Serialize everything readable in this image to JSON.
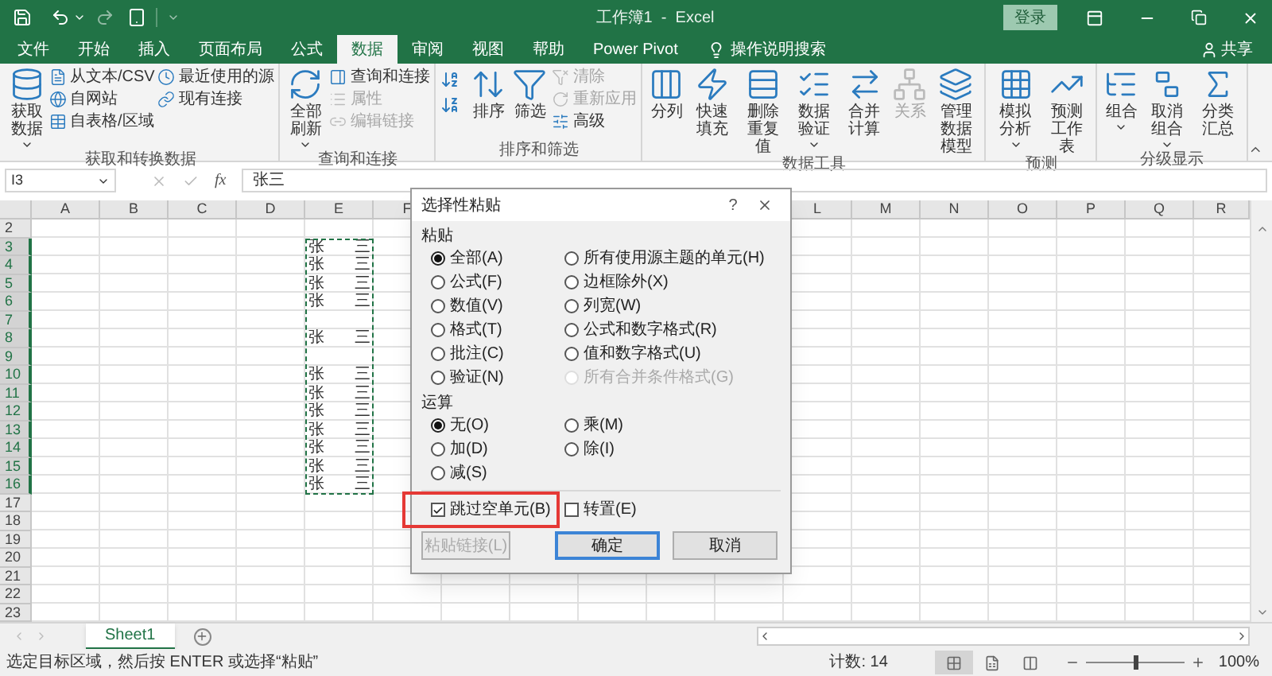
{
  "title_bar": {
    "title": "工作簿1  -  Excel",
    "login_button": "登录"
  },
  "ribbon_tabs": [
    {
      "label": "文件",
      "selected": false
    },
    {
      "label": "开始",
      "selected": false
    },
    {
      "label": "插入",
      "selected": false
    },
    {
      "label": "页面布局",
      "selected": false
    },
    {
      "label": "公式",
      "selected": false
    },
    {
      "label": "数据",
      "selected": true
    },
    {
      "label": "审阅",
      "selected": false
    },
    {
      "label": "视图",
      "selected": false
    },
    {
      "label": "帮助",
      "selected": false
    },
    {
      "label": "Power Pivot",
      "selected": false
    }
  ],
  "tell_me": "操作说明搜索",
  "share": "共享",
  "ribbon_groups": [
    {
      "label": "获取和转换数据",
      "items": [
        {
          "kind": "large",
          "label": "获取数据",
          "dropdown": true,
          "disabled": false
        },
        {
          "kind": "stack",
          "items": [
            {
              "label": "从文本/CSV",
              "disabled": false
            },
            {
              "label": "自网站",
              "disabled": false
            },
            {
              "label": "自表格/区域",
              "disabled": false
            }
          ]
        },
        {
          "kind": "stack",
          "items": [
            {
              "label": "最近使用的源",
              "disabled": false
            },
            {
              "label": "现有连接",
              "disabled": false
            }
          ]
        }
      ]
    },
    {
      "label": "查询和连接",
      "items": [
        {
          "kind": "large",
          "label": "全部刷新",
          "dropdown": true,
          "disabled": false
        },
        {
          "kind": "stack",
          "items": [
            {
              "label": "查询和连接",
              "disabled": false
            },
            {
              "label": "属性",
              "disabled": true
            },
            {
              "label": "编辑链接",
              "disabled": true
            }
          ]
        }
      ]
    },
    {
      "label": "排序和筛选",
      "items": [
        {
          "kind": "sort_icons"
        },
        {
          "kind": "large",
          "label": "排序",
          "dropdown": false,
          "disabled": false
        },
        {
          "kind": "large",
          "label": "筛选",
          "dropdown": false,
          "disabled": false
        },
        {
          "kind": "stack",
          "items": [
            {
              "label": "清除",
              "disabled": true
            },
            {
              "label": "重新应用",
              "disabled": true
            },
            {
              "label": "高级",
              "disabled": false
            }
          ]
        }
      ]
    },
    {
      "label": "数据工具",
      "items": [
        {
          "kind": "large",
          "label": "分列",
          "dropdown": false,
          "disabled": false
        },
        {
          "kind": "large",
          "label": "快速填充",
          "dropdown": false,
          "disabled": false
        },
        {
          "kind": "large",
          "label": "删除重复值",
          "dropdown": false,
          "disabled": false
        },
        {
          "kind": "large",
          "label": "数据验证",
          "dropdown": true,
          "disabled": false
        },
        {
          "kind": "large",
          "label": "合并计算",
          "dropdown": false,
          "disabled": false
        },
        {
          "kind": "large",
          "label": "关系",
          "dropdown": false,
          "disabled": true
        },
        {
          "kind": "large",
          "label": "管理数据模型",
          "dropdown": false,
          "disabled": false
        }
      ]
    },
    {
      "label": "预测",
      "items": [
        {
          "kind": "large",
          "label": "模拟分析",
          "dropdown": true,
          "disabled": false
        },
        {
          "kind": "large",
          "label": "预测工作表",
          "dropdown": false,
          "disabled": false
        }
      ]
    },
    {
      "label": "分级显示",
      "items": [
        {
          "kind": "large",
          "label": "组合",
          "dropdown": true,
          "disabled": false
        },
        {
          "kind": "large",
          "label": "取消组合",
          "dropdown": true,
          "disabled": false
        },
        {
          "kind": "large",
          "label": "分类汇总",
          "dropdown": false,
          "disabled": false
        }
      ]
    }
  ],
  "formula_bar": {
    "name_box": "I3",
    "function_label": "fx",
    "value": "张三"
  },
  "grid": {
    "columns": [
      "A",
      "B",
      "C",
      "D",
      "E",
      "F",
      null,
      null,
      null,
      null,
      null,
      "L",
      "M",
      "N",
      "O",
      "P",
      "Q",
      "R"
    ],
    "rows": [
      {
        "label": "2",
        "selected": false,
        "cells": []
      },
      {
        "label": "3",
        "selected": true,
        "cells": [
          null,
          null,
          null,
          null,
          "张三"
        ]
      },
      {
        "label": "4",
        "selected": true,
        "cells": [
          null,
          null,
          null,
          null,
          "张三"
        ]
      },
      {
        "label": "5",
        "selected": true,
        "cells": [
          null,
          null,
          null,
          null,
          "张三"
        ]
      },
      {
        "label": "6",
        "selected": true,
        "cells": [
          null,
          null,
          null,
          null,
          "张三"
        ]
      },
      {
        "label": "7",
        "selected": true,
        "cells": []
      },
      {
        "label": "8",
        "selected": true,
        "cells": [
          null,
          null,
          null,
          null,
          "张三"
        ]
      },
      {
        "label": "9",
        "selected": true,
        "cells": []
      },
      {
        "label": "10",
        "selected": true,
        "cells": [
          null,
          null,
          null,
          null,
          "张三"
        ]
      },
      {
        "label": "11",
        "selected": true,
        "cells": [
          null,
          null,
          null,
          null,
          "张三"
        ]
      },
      {
        "label": "12",
        "selected": true,
        "cells": [
          null,
          null,
          null,
          null,
          "张三"
        ]
      },
      {
        "label": "13",
        "selected": true,
        "cells": [
          null,
          null,
          null,
          null,
          "张三"
        ]
      },
      {
        "label": "14",
        "selected": true,
        "cells": [
          null,
          null,
          null,
          null,
          "张三"
        ]
      },
      {
        "label": "15",
        "selected": true,
        "cells": [
          null,
          null,
          null,
          null,
          "张三"
        ]
      },
      {
        "label": "16",
        "selected": true,
        "cells": [
          null,
          null,
          null,
          null,
          "张三"
        ]
      },
      {
        "label": "17",
        "selected": false,
        "cells": []
      },
      {
        "label": "18",
        "selected": false,
        "cells": []
      },
      {
        "label": "19",
        "selected": false,
        "cells": []
      },
      {
        "label": "20",
        "selected": false,
        "cells": []
      },
      {
        "label": "21",
        "selected": false,
        "cells": []
      },
      {
        "label": "22",
        "selected": false,
        "cells": []
      },
      {
        "label": "23",
        "selected": false,
        "cells": []
      }
    ]
  },
  "dialog": {
    "title": "选择性粘贴",
    "help": "?",
    "paste_label": "粘贴",
    "paste_options": [
      {
        "label": "全部(A)",
        "selected": true,
        "disabled": false
      },
      {
        "label": "所有使用源主题的单元(H)",
        "selected": false,
        "disabled": false
      },
      {
        "label": "公式(F)",
        "selected": false,
        "disabled": false
      },
      {
        "label": "边框除外(X)",
        "selected": false,
        "disabled": false
      },
      {
        "label": "数值(V)",
        "selected": false,
        "disabled": false
      },
      {
        "label": "列宽(W)",
        "selected": false,
        "disabled": false
      },
      {
        "label": "格式(T)",
        "selected": false,
        "disabled": false
      },
      {
        "label": "公式和数字格式(R)",
        "selected": false,
        "disabled": false
      },
      {
        "label": "批注(C)",
        "selected": false,
        "disabled": false
      },
      {
        "label": "值和数字格式(U)",
        "selected": false,
        "disabled": false
      },
      {
        "label": "验证(N)",
        "selected": false,
        "disabled": false
      },
      {
        "label": "所有合并条件格式(G)",
        "selected": false,
        "disabled": true
      }
    ],
    "operation_label": "运算",
    "operation_options": [
      {
        "label": "无(O)",
        "selected": true,
        "disabled": false
      },
      {
        "label": "乘(M)",
        "selected": false,
        "disabled": false
      },
      {
        "label": "加(D)",
        "selected": false,
        "disabled": false
      },
      {
        "label": "除(I)",
        "selected": false,
        "disabled": false
      },
      {
        "label": "减(S)",
        "selected": false,
        "disabled": false
      }
    ],
    "checkboxes": [
      {
        "label": "跳过空单元(B)",
        "checked": true,
        "highlighted": true
      },
      {
        "label": "转置(E)",
        "checked": false,
        "highlighted": false
      }
    ],
    "buttons": [
      {
        "label": "粘贴链接(L)",
        "disabled": true,
        "default": false
      },
      {
        "label": "确定",
        "disabled": false,
        "default": true
      },
      {
        "label": "取消",
        "disabled": false,
        "default": false
      }
    ]
  },
  "sheets": [
    {
      "label": "Sheet1",
      "selected": true
    }
  ],
  "status_bar": {
    "message": "选定目标区域，然后按 ENTER 或选择“粘贴”",
    "count": "计数: 14",
    "view_buttons": [
      {
        "selected": true
      },
      {
        "selected": false
      },
      {
        "selected": false
      }
    ],
    "zoom": {
      "level": 0.5,
      "reading": "100%"
    }
  }
}
